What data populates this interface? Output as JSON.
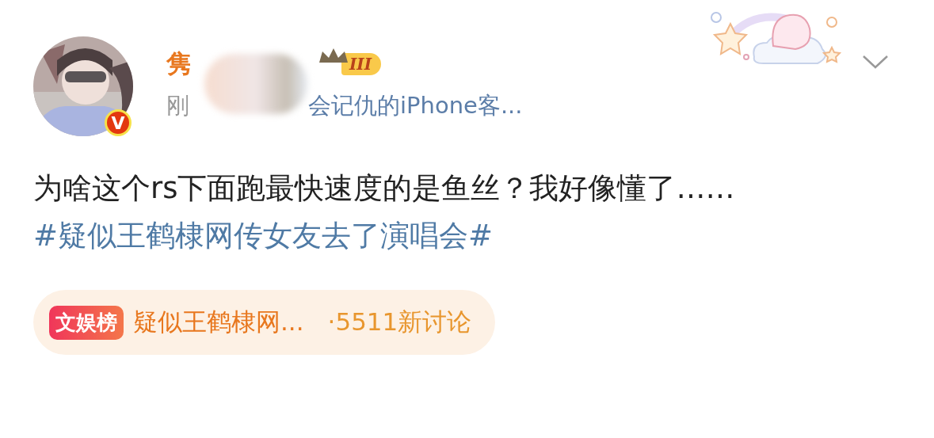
{
  "author": {
    "name": "隽",
    "level_badge": "III",
    "verified_badge": "V"
  },
  "meta": {
    "time": "刚",
    "source": "会记仇的iPhone客..."
  },
  "post": {
    "text": "为啥这个rs下面跑最快速度的是鱼丝？我好像懂了……",
    "hashtag": "#疑似王鹤棣网传女友去了演唱会#"
  },
  "topic_card": {
    "badge": "文娱榜",
    "title": "疑似王鹤棣网...",
    "count": "·5511新讨论"
  }
}
